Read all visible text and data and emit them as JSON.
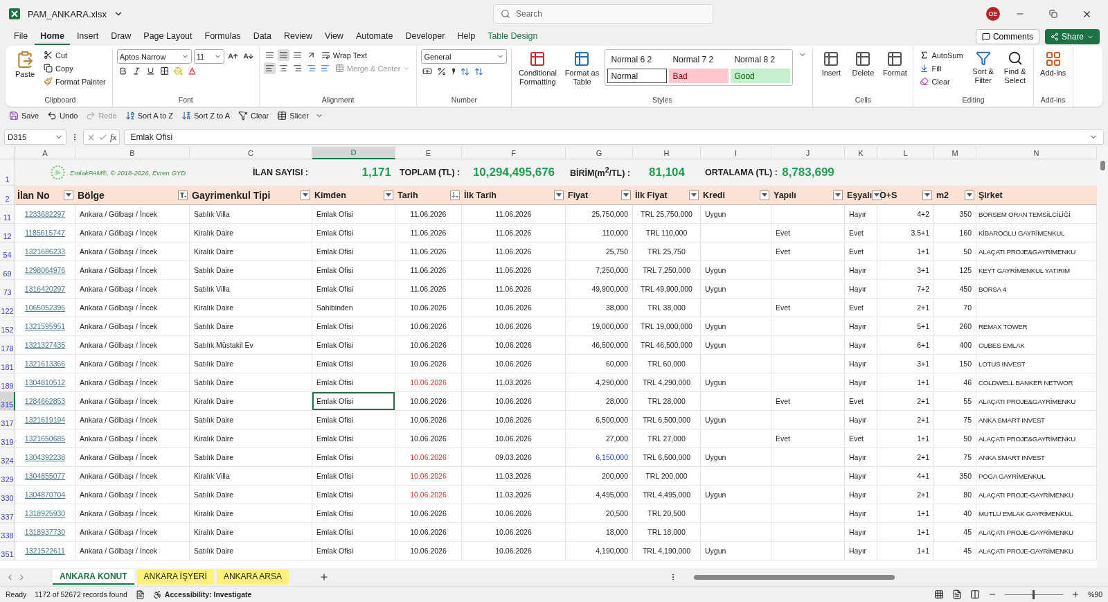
{
  "window": {
    "title": "PAM_ANKARA.xlsx",
    "search_placeholder": "Search",
    "avatar": "OE"
  },
  "menu": [
    {
      "label": "File",
      "selected": false,
      "contextual": false
    },
    {
      "label": "Home",
      "selected": true,
      "contextual": false
    },
    {
      "label": "Insert",
      "selected": false,
      "contextual": false
    },
    {
      "label": "Draw",
      "selected": false,
      "contextual": false
    },
    {
      "label": "Page Layout",
      "selected": false,
      "contextual": false
    },
    {
      "label": "Formulas",
      "selected": false,
      "contextual": false
    },
    {
      "label": "Data",
      "selected": false,
      "contextual": false
    },
    {
      "label": "Review",
      "selected": false,
      "contextual": false
    },
    {
      "label": "View",
      "selected": false,
      "contextual": false
    },
    {
      "label": "Automate",
      "selected": false,
      "contextual": false
    },
    {
      "label": "Developer",
      "selected": false,
      "contextual": false
    },
    {
      "label": "Help",
      "selected": false,
      "contextual": false
    },
    {
      "label": "Table Design",
      "selected": false,
      "contextual": true
    }
  ],
  "comments": "Comments",
  "share": "Share",
  "clipboard": {
    "label": "Clipboard",
    "paste": "Paste",
    "cut": "Cut",
    "copy": "Copy",
    "painter": "Format Painter"
  },
  "font": {
    "label": "Font",
    "name": "Aptos Narrow",
    "size": "11"
  },
  "alignment": {
    "label": "Alignment",
    "wrap": "Wrap Text",
    "merge": {
      "label": "Merge & Center",
      "disabled": true
    }
  },
  "number": {
    "label": "Number",
    "format": "General"
  },
  "styles": {
    "label": "Styles",
    "conditional": "Conditional Formatting",
    "format_table": "Format as Table",
    "cells": [
      {
        "text": "Normal 6 2",
        "kind": "plain"
      },
      {
        "text": "Normal 7 2",
        "kind": "plain"
      },
      {
        "text": "Normal 8 2",
        "kind": "plain"
      },
      {
        "text": "Normal",
        "kind": "boxed"
      },
      {
        "text": "Bad",
        "kind": "bad"
      },
      {
        "text": "Good",
        "kind": "good"
      }
    ]
  },
  "cells_group": {
    "label": "Cells",
    "buttons": [
      "Insert",
      "Delete",
      "Format"
    ]
  },
  "editing": {
    "label": "Editing",
    "autosum": "AutoSum",
    "fill": "Fill",
    "clear": "Clear",
    "sort": "Sort & Filter",
    "find": "Find & Select"
  },
  "addins": {
    "label": "Add-ins",
    "button": "Add-ins"
  },
  "quick_access": [
    {
      "label": "Save",
      "kind": "save",
      "disabled": false
    },
    {
      "label": "Undo",
      "kind": "undo",
      "disabled": false
    },
    {
      "label": "Redo",
      "kind": "redo",
      "disabled": true
    },
    {
      "label": "Sort A to Z",
      "kind": "sort_az",
      "disabled": false
    },
    {
      "label": "Sort Z to A",
      "kind": "sort_za",
      "disabled": false
    },
    {
      "label": "Clear",
      "kind": "clear",
      "disabled": false
    },
    {
      "label": "Slicer",
      "kind": "slicer",
      "disabled": false
    }
  ],
  "formula_bar": {
    "name_box": "D315",
    "fx": "fx",
    "value": "Emlak Ofisi"
  },
  "summary": {
    "row_number": "1",
    "logo_text": "EmlakPAM®, © 2018-2026, Evren GYD",
    "stats": [
      {
        "label": "İLAN SAYISI :",
        "value": "1,171"
      },
      {
        "label": "TOPLAM (TL) :",
        "value": "10,294,495,676"
      },
      {
        "label": "BİRİM(m$^{2}$/TL) :",
        "value": "81,104"
      },
      {
        "label": "ORTALAMA (TL) :",
        "value": "8,783,699"
      }
    ]
  },
  "header_row_number": "2",
  "columns": [
    {
      "letter": "A",
      "title": "İlan No",
      "kind": "dropdown",
      "selected": false
    },
    {
      "letter": "B",
      "title": "Bölge",
      "kind": "filtered",
      "selected": false
    },
    {
      "letter": "C",
      "title": "Gayrimenkul Tipi",
      "kind": "dropdown",
      "selected": false
    },
    {
      "letter": "D",
      "title": "Kimden",
      "kind": "dropdown",
      "selected": true
    },
    {
      "letter": "E",
      "title": "Tarih",
      "kind": "sorted",
      "selected": false
    },
    {
      "letter": "F",
      "title": "İlk Tarih",
      "kind": "dropdown",
      "selected": false
    },
    {
      "letter": "G",
      "title": "Fiyat",
      "kind": "dropdown",
      "selected": false
    },
    {
      "letter": "H",
      "title": "İlk Fiyat",
      "kind": "dropdown",
      "selected": false
    },
    {
      "letter": "I",
      "title": "Kredi",
      "kind": "dropdown",
      "selected": false
    },
    {
      "letter": "J",
      "title": "Yapılı",
      "kind": "dropdown",
      "selected": false
    },
    {
      "letter": "K",
      "title": "Eşyalı",
      "kind": "dropdown",
      "selected": false
    },
    {
      "letter": "L",
      "title": "O+S",
      "kind": "dropdown",
      "selected": false
    },
    {
      "letter": "M",
      "title": "m2",
      "kind": "dropdown",
      "selected": false
    },
    {
      "letter": "N",
      "title": "Şirket",
      "kind": "none",
      "selected": false
    }
  ],
  "rows": [
    {
      "n": "11",
      "selected": false,
      "date_flagged": false,
      "price_flagged": false,
      "cells": [
        "1233682297",
        "Ankara / Gölbaşı / İncek",
        "Satılık Villa",
        "Emlak Ofisi",
        "11.06.2026",
        "11.06.2026",
        "25,750,000",
        "TRL 25,750,000",
        "Uygun",
        null,
        "Hayır",
        "4+2",
        "350",
        "BORSEM ORAN TEMSİLCİLİĞİ"
      ]
    },
    {
      "n": "12",
      "selected": false,
      "date_flagged": false,
      "price_flagged": false,
      "cells": [
        "1185615747",
        "Ankara / Gölbaşı / İncek",
        "Kiralık Daire",
        "Emlak Ofisi",
        "11.06.2026",
        "11.06.2026",
        "110,000",
        "TRL 110,000",
        null,
        "Evet",
        "Evet",
        "3.5+1",
        "160",
        "KİBAROGLU GAYRİMENKUL"
      ]
    },
    {
      "n": "54",
      "selected": false,
      "date_flagged": false,
      "price_flagged": false,
      "cells": [
        "1321686233",
        "Ankara / Gölbaşı / İncek",
        "Kiralık Daire",
        "Emlak Ofisi",
        "11.06.2026",
        "11.06.2026",
        "25,750",
        "TRL 25,750",
        null,
        "Evet",
        "Evet",
        "1+1",
        "50",
        "ALAÇATI PROJE&GAYRİMENKU"
      ]
    },
    {
      "n": "69",
      "selected": false,
      "date_flagged": false,
      "price_flagged": false,
      "cells": [
        "1298064976",
        "Ankara / Gölbaşı / İncek",
        "Satılık Daire",
        "Emlak Ofisi",
        "11.06.2026",
        "11.06.2026",
        "7,250,000",
        "TRL 7,250,000",
        "Uygun",
        null,
        "Hayır",
        "3+1",
        "125",
        "KEYT GAYRİMENKUL YATIRIM"
      ]
    },
    {
      "n": "73",
      "selected": false,
      "date_flagged": false,
      "price_flagged": false,
      "cells": [
        "1316420297",
        "Ankara / Gölbaşı / İncek",
        "Satılık Villa",
        "Emlak Ofisi",
        "11.06.2026",
        "11.06.2026",
        "49,900,000",
        "TRL 49,900,000",
        "Uygun",
        null,
        "Hayır",
        "7+2",
        "450",
        "BORSA 4"
      ]
    },
    {
      "n": "122",
      "selected": false,
      "date_flagged": false,
      "price_flagged": false,
      "cells": [
        "1065052396",
        "Ankara / Gölbaşı / İncek",
        "Kiralık Daire",
        "Sahibinden",
        "10.06.2026",
        "10.06.2026",
        "38,000",
        "TRL 38,000",
        null,
        "Evet",
        "Evet",
        "2+1",
        "70",
        null
      ]
    },
    {
      "n": "152",
      "selected": false,
      "date_flagged": false,
      "price_flagged": false,
      "cells": [
        "1321595951",
        "Ankara / Gölbaşı / İncek",
        "Satılık Daire",
        "Emlak Ofisi",
        "10.06.2026",
        "10.06.2026",
        "19,000,000",
        "TRL 19,000,000",
        "Uygun",
        null,
        "Hayır",
        "5+1",
        "260",
        "REMAX TOWER"
      ]
    },
    {
      "n": "178",
      "selected": false,
      "date_flagged": false,
      "price_flagged": false,
      "cells": [
        "1321327435",
        "Ankara / Gölbaşı / İncek",
        "Satılık Müstakil Ev",
        "Emlak Ofisi",
        "10.06.2026",
        "10.06.2026",
        "46,500,000",
        "TRL 46,500,000",
        "Uygun",
        null,
        "Hayır",
        "6+1",
        "400",
        "CUBES EMLAK"
      ]
    },
    {
      "n": "181",
      "selected": false,
      "date_flagged": false,
      "price_flagged": false,
      "cells": [
        "1321613366",
        "Ankara / Gölbaşı / İncek",
        "Satılık Daire",
        "Emlak Ofisi",
        "10.06.2026",
        "10.06.2026",
        "60,000",
        "TRL 60,000",
        null,
        null,
        "Hayır",
        "3+1",
        "150",
        "LOTUS INVEST"
      ]
    },
    {
      "n": "189",
      "selected": false,
      "date_flagged": true,
      "price_flagged": false,
      "cells": [
        "1304810512",
        "Ankara / Gölbaşı / İncek",
        "Satılık Daire",
        "Emlak Ofisi",
        "10.06.2026",
        "11.03.2026",
        "4,290,000",
        "TRL 4,290,000",
        "Uygun",
        null,
        "Hayır",
        "1+1",
        "46",
        "COLDWELL BANKER NETWOR"
      ]
    },
    {
      "n": "315",
      "selected": true,
      "date_flagged": false,
      "price_flagged": false,
      "cells": [
        "1284662853",
        "Ankara / Gölbaşı / İncek",
        "Kiralık Daire",
        "Emlak Ofisi",
        "10.06.2026",
        "10.06.2026",
        "28,000",
        "TRL 28,000",
        null,
        "Evet",
        "Evet",
        "2+1",
        "55",
        "ALAÇATI PROJE&GAYRİMENKU"
      ]
    },
    {
      "n": "317",
      "selected": false,
      "date_flagged": false,
      "price_flagged": false,
      "cells": [
        "1321619194",
        "Ankara / Gölbaşı / İncek",
        "Satılık Daire",
        "Emlak Ofisi",
        "10.06.2026",
        "10.06.2026",
        "6,500,000",
        "TRL 6,500,000",
        "Uygun",
        null,
        "Hayır",
        "2+1",
        "75",
        "ANKA SMART INVEST"
      ]
    },
    {
      "n": "319",
      "selected": false,
      "date_flagged": false,
      "price_flagged": false,
      "cells": [
        "1321650685",
        "Ankara / Gölbaşı / İncek",
        "Kiralık Daire",
        "Emlak Ofisi",
        "10.06.2026",
        "10.06.2026",
        "27,000",
        "TRL 27,000",
        null,
        "Evet",
        "Evet",
        "1+1",
        "50",
        "ALAÇATI PROJE&GAYRİMENKU"
      ]
    },
    {
      "n": "324",
      "selected": false,
      "date_flagged": true,
      "price_flagged": true,
      "cells": [
        "1304392238",
        "Ankara / Gölbaşı / İncek",
        "Satılık Daire",
        "Emlak Ofisi",
        "10.06.2026",
        "09.03.2026",
        "6,150,000",
        "TRL 6,500,000",
        "Uygun",
        null,
        "Hayır",
        "2+1",
        "75",
        "ANKA SMART INVEST"
      ]
    },
    {
      "n": "329",
      "selected": false,
      "date_flagged": true,
      "price_flagged": false,
      "cells": [
        "1304855077",
        "Ankara / Gölbaşı / İncek",
        "Kiralık Villa",
        "Emlak Ofisi",
        "10.06.2026",
        "11.03.2026",
        "200,000",
        "TRL 200,000",
        null,
        null,
        "Hayır",
        "4+1",
        "350",
        "POGA GAYRİMENKUL"
      ]
    },
    {
      "n": "330",
      "selected": false,
      "date_flagged": true,
      "price_flagged": false,
      "cells": [
        "1304870704",
        "Ankara / Gölbaşı / İncek",
        "Satılık Daire",
        "Emlak Ofisi",
        "10.06.2026",
        "11.03.2026",
        "4,495,000",
        "TRL 4,495,000",
        "Uygun",
        null,
        "Hayır",
        "2+1",
        "80",
        "ALAÇATI PROJE-GAYRİMENKU"
      ]
    },
    {
      "n": "337",
      "selected": false,
      "date_flagged": false,
      "price_flagged": false,
      "cells": [
        "1318925930",
        "Ankara / Gölbaşı / İncek",
        "Kiralık Daire",
        "Emlak Ofisi",
        "10.06.2026",
        "10.06.2026",
        "20,500",
        "TRL 20,500",
        null,
        null,
        "Hayır",
        "1+1",
        "40",
        "MUTLU EMLAK GAYRİMENKUL"
      ]
    },
    {
      "n": "338",
      "selected": false,
      "date_flagged": false,
      "price_flagged": false,
      "cells": [
        "1318937730",
        "Ankara / Gölbaşı / İncek",
        "Kiralık Daire",
        "Emlak Ofisi",
        "10.06.2026",
        "10.06.2026",
        "18,000",
        "TRL 18,000",
        null,
        null,
        "Hayır",
        "1+1",
        "45",
        "ALAÇATI PROJE-GAYRİMENKU"
      ]
    },
    {
      "n": "351",
      "selected": false,
      "date_flagged": false,
      "price_flagged": false,
      "cells": [
        "1321522611",
        "Ankara / Gölbaşı / İncek",
        "Satılık Daire",
        "Emlak Ofisi",
        "10.06.2026",
        "10.06.2026",
        "4,190,000",
        "TRL 4,190,000",
        "Uygun",
        null,
        "Hayır",
        "1+1",
        "45",
        "ALAÇATI PROJE-GAYRİMENKU"
      ]
    }
  ],
  "sheets": [
    {
      "label": "ANKARA KONUT",
      "selected": true
    },
    {
      "label": "ANKARA İŞYERİ",
      "selected": false
    },
    {
      "label": "ANKARA ARSA",
      "selected": false
    }
  ],
  "status": {
    "ready": "Ready",
    "records": "1172 of 52672 records found",
    "accessibility": "Accessibility: Investigate",
    "zoom": "%90",
    "zoom_slider": {
      "level": 0.48
    }
  }
}
